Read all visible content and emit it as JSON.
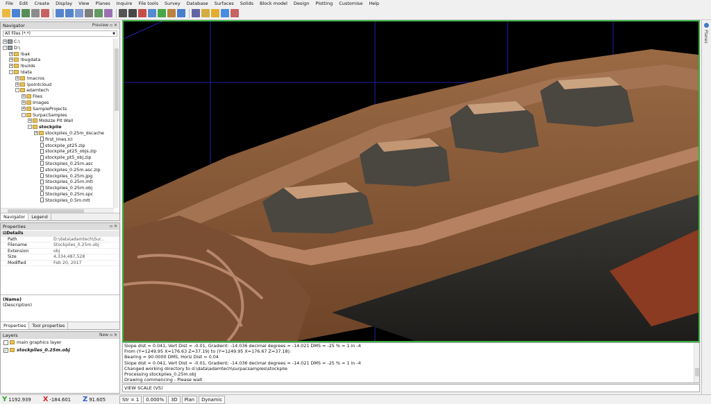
{
  "menu": [
    "File",
    "Edit",
    "Create",
    "Display",
    "View",
    "Planes",
    "Inquire",
    "File tools",
    "Survey",
    "Database",
    "Surfaces",
    "Solids",
    "Block model",
    "Design",
    "Plotting",
    "Customise",
    "Help"
  ],
  "toolbar_icons": [
    "new-icon",
    "open-icon",
    "save-icon",
    "print-icon",
    "cut-icon",
    "undo-icon",
    "redo-icon",
    "redraw-icon",
    "zoom-icon",
    "pan-icon",
    "rotate-icon",
    "select-icon",
    "pointer-icon",
    "line-icon",
    "polygon-icon",
    "point-icon",
    "measure-icon",
    "grid-icon",
    "layer-icon",
    "light-icon",
    "sun-icon",
    "globe-icon",
    "tools-icon"
  ],
  "navigator": {
    "title": "Navigator",
    "preview": "Preview",
    "filter": "All Files (*.*)",
    "tree": [
      {
        "label": "C:\\",
        "indent": 0,
        "icon": "drive",
        "exp": "+"
      },
      {
        "label": "D:\\",
        "indent": 0,
        "icon": "drive",
        "exp": "-"
      },
      {
        "label": "!bak",
        "indent": 1,
        "icon": "folder",
        "exp": "+"
      },
      {
        "label": "!bugdata",
        "indent": 1,
        "icon": "folder",
        "exp": "+"
      },
      {
        "label": "!builds",
        "indent": 1,
        "icon": "folder",
        "exp": "+"
      },
      {
        "label": "!data",
        "indent": 1,
        "icon": "folder",
        "exp": "-"
      },
      {
        "label": "!macros",
        "indent": 2,
        "icon": "folder",
        "exp": "+"
      },
      {
        "label": "!pointcloud",
        "indent": 2,
        "icon": "folder",
        "exp": "+"
      },
      {
        "label": "adamtech",
        "indent": 2,
        "icon": "folder",
        "exp": "-"
      },
      {
        "label": "Files",
        "indent": 3,
        "icon": "folder",
        "exp": "+"
      },
      {
        "label": "Images",
        "indent": 3,
        "icon": "folder",
        "exp": "+"
      },
      {
        "label": "SampleProjects",
        "indent": 3,
        "icon": "folder",
        "exp": "+"
      },
      {
        "label": "SurpacSamples",
        "indent": 3,
        "icon": "folder",
        "exp": "-"
      },
      {
        "label": "Midsize Pit Wall",
        "indent": 4,
        "icon": "folder",
        "exp": "+"
      },
      {
        "label": "stockpile",
        "indent": 4,
        "icon": "folder",
        "exp": "-",
        "bold": true
      },
      {
        "label": "stockpiles_0.25m_dscache",
        "indent": 5,
        "icon": "folder",
        "exp": "+"
      },
      {
        "label": "first_lines.lcl",
        "indent": 5,
        "icon": "file",
        "exp": ""
      },
      {
        "label": "stockpile_pt25.zip",
        "indent": 5,
        "icon": "file",
        "exp": ""
      },
      {
        "label": "stockpile_pt25_objs.zip",
        "indent": 5,
        "icon": "file",
        "exp": ""
      },
      {
        "label": "stockpile_pt5_obj.zip",
        "indent": 5,
        "icon": "file",
        "exp": ""
      },
      {
        "label": "Stockpiles_0.25m.asc",
        "indent": 5,
        "icon": "file",
        "exp": ""
      },
      {
        "label": "stockpiles_0.25m.asc.zip",
        "indent": 5,
        "icon": "file",
        "exp": ""
      },
      {
        "label": "Stockpiles_0.25m.jpg",
        "indent": 5,
        "icon": "file",
        "exp": ""
      },
      {
        "label": "Stockpiles_0.25m.mtl",
        "indent": 5,
        "icon": "file",
        "exp": ""
      },
      {
        "label": "Stockpiles_0.25m.obj",
        "indent": 5,
        "icon": "file",
        "exp": ""
      },
      {
        "label": "Stockpiles_0.25m.spc",
        "indent": 5,
        "icon": "file",
        "exp": ""
      },
      {
        "label": "Stockpiles_0.5m.mtl",
        "indent": 5,
        "icon": "file",
        "exp": ""
      }
    ],
    "tabs": [
      "Navigator",
      "Legend"
    ]
  },
  "properties": {
    "title": "Properties",
    "section": "Details",
    "rows": [
      {
        "k": "Path",
        "v": "D:\\data\\adamtech\\Sur..."
      },
      {
        "k": "Filename",
        "v": "Stockpiles_0.25m.obj"
      },
      {
        "k": "Extension",
        "v": "obj"
      },
      {
        "k": "Size",
        "v": "4,334,487,528"
      },
      {
        "k": "Modified",
        "v": "Feb 20, 2017"
      }
    ],
    "desc_name": "(Name)",
    "desc_text": "(Description)",
    "tabs": [
      "Properties",
      "Tool properties"
    ]
  },
  "layers": {
    "title": "Layers",
    "new_btn": "New",
    "items": [
      {
        "label": "main graphics layer",
        "checked": false,
        "bold": false
      },
      {
        "label": "stockpiles_0.25m.obj",
        "checked": true,
        "bold": true
      }
    ]
  },
  "console": [
    "Slope dist = 0.041, Vert Dist = -0.01, Gradient: -14.036 decimal degrees = -14.021 DMS = -25 % = 1 in -4",
    "From (Y=1249.95 X=176.63 Z=37.19) to (Y=1249.95 X=176.67 Z=37.18):",
    "Bearing = 90.0000 DMS, Horiz Dist = 0.04",
    "Slope dist = 0.041, Vert Dist = -0.01, Gradient: -14.036 decimal degrees = -14.021 DMS = -25 % = 1 in -4",
    "Changed working directory to d:\\data\\adamtech\\surpacsamples\\stockpile",
    "Processing stockpiles_0.25m.obj",
    "Drawing commencing - Please wait"
  ],
  "command": "VIEW SCALE (VS)",
  "right_panel": "Planes",
  "status": {
    "y": "1192.939",
    "x": "-184.601",
    "z": "91.605",
    "str_label": "Str = 1",
    "zoom": "0.000%",
    "buttons": [
      "3D",
      "Plan",
      "Dynamic"
    ]
  },
  "colors": {
    "viewport_border": "#3cb043",
    "grid": "#2b2bd6",
    "terrain": "#8a5a38"
  }
}
